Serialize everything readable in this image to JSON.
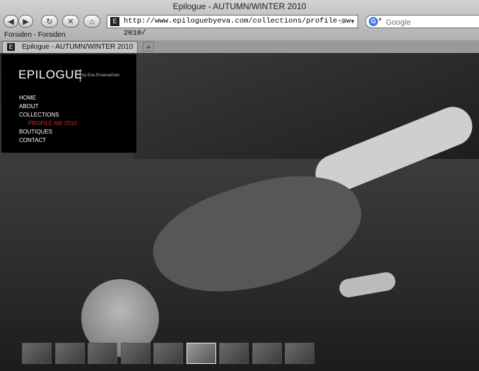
{
  "window": {
    "title": "Epilogue - AUTUMN/WINTER 2010"
  },
  "toolbar": {
    "back_icon": "back-arrow-icon",
    "forward_icon": "forward-arrow-icon",
    "reload_icon": "reload-icon",
    "stop_icon": "stop-icon",
    "home_icon": "home-icon",
    "url": "http://www.epiloguebyeva.com/collections/profile-aw-2010/",
    "search_placeholder": "Google"
  },
  "bookmarks": {
    "item": "Forsiden - Forsiden"
  },
  "tabs": [
    {
      "label": "Epilogue - AUTUMN/WINTER 2010"
    }
  ],
  "site": {
    "logo": "EPILOGUE",
    "logo_sub": "by Eva Emanuelsen",
    "menu": [
      {
        "label": "HOME"
      },
      {
        "label": "ABOUT"
      },
      {
        "label": "COLLECTIONS"
      },
      {
        "label": "PROFILE AW 2010",
        "active": true
      },
      {
        "label": "BOUTIQUES"
      },
      {
        "label": "CONTACT"
      }
    ],
    "accent_color": "#d8232a",
    "thumbnail_count": 9,
    "active_thumbnail": 6
  }
}
